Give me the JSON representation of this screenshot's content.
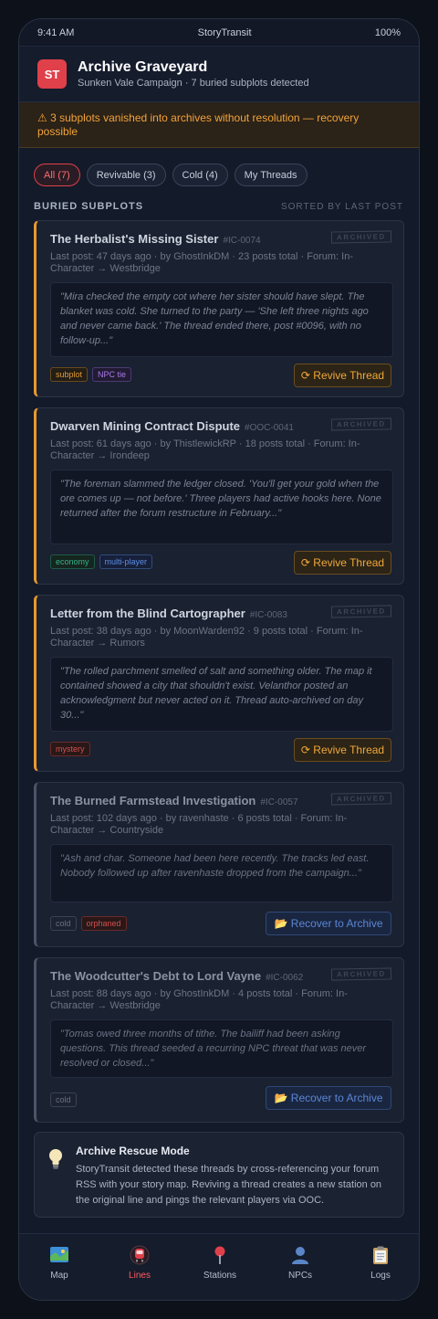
{
  "status": {
    "time": "9:41 AM",
    "app": "StoryTransit",
    "battery": "100%"
  },
  "header": {
    "logo": "ST",
    "title": "Archive Graveyard",
    "subtitle": "Sunken Vale Campaign · 7 buried subplots detected"
  },
  "banner": {
    "icon": "warning-icon",
    "text": "⚠ 3 subplots vanished into archives without resolution — recovery possible"
  },
  "filters": [
    {
      "label": "All (7)",
      "active": true
    },
    {
      "label": "Revivable (3)",
      "active": false
    },
    {
      "label": "Cold (4)",
      "active": false
    },
    {
      "label": "My Threads",
      "active": false
    }
  ],
  "section": {
    "title": "BURIED SUBPLOTS",
    "sort": "SORTED BY LAST POST"
  },
  "stamp": "ARCHIVED",
  "threads": [
    {
      "title": "The Herbalist's Missing Sister",
      "id": "#IC-0074",
      "meta": "Last post: 47 days ago · by GhostInkDM · 23 posts total · Forum: In-Character → Westbridge",
      "quote": "\"Mira checked the empty cot where her sister should have slept. The blanket was cold. She turned to the party — 'She left three nights ago and never came back.' The thread ended there, post #0096, with no follow-up...\"",
      "tags": [
        "subplot",
        "NPC tie"
      ],
      "action": "⟳ Revive Thread",
      "state": "revivable"
    },
    {
      "title": "Dwarven Mining Contract Dispute",
      "id": "#OOC-0041",
      "meta": "Last post: 61 days ago · by ThistlewickRP · 18 posts total · Forum: In-Character → Irondeep",
      "quote": "\"The foreman slammed the ledger closed. 'You'll get your gold when the ore comes up — not before.' Three players had active hooks here. None returned after the forum restructure in February...\"",
      "tags": [
        "economy",
        "multi-player"
      ],
      "action": "⟳ Revive Thread",
      "state": "revivable"
    },
    {
      "title": "Letter from the Blind Cartographer",
      "id": "#IC-0083",
      "meta": "Last post: 38 days ago · by MoonWarden92 · 9 posts total · Forum: In-Character → Rumors",
      "quote": "\"The rolled parchment smelled of salt and something older. The map it contained showed a city that shouldn't exist. Velanthor posted an acknowledgment but never acted on it. Thread auto-archived on day 30...\"",
      "tags": [
        "mystery"
      ],
      "action": "⟳ Revive Thread",
      "state": "revivable"
    },
    {
      "title": "The Burned Farmstead Investigation",
      "id": "#IC-0057",
      "meta": "Last post: 102 days ago · by ravenhaste · 6 posts total · Forum: In-Character → Countryside",
      "quote": "\"Ash and char. Someone had been here recently. The tracks led east. Nobody followed up after ravenhaste dropped from the campaign...\"",
      "tags": [
        "cold",
        "orphaned"
      ],
      "action": "📂 Recover to Archive",
      "state": "cold"
    },
    {
      "title": "The Woodcutter's Debt to Lord Vayne",
      "id": "#IC-0062",
      "meta": "Last post: 88 days ago · by GhostInkDM · 4 posts total · Forum: In-Character → Westbridge",
      "quote": "\"Tomas owed three months of tithe. The bailiff had been asking questions. This thread seeded a recurring NPC threat that was never resolved or closed...\"",
      "tags": [
        "cold"
      ],
      "action": "📂 Recover to Archive",
      "state": "cold"
    }
  ],
  "rescue": {
    "icon": "lightbulb-icon",
    "title": "Archive Rescue Mode",
    "text": "StoryTransit detected these threads by cross-referencing your forum RSS with your story map. Reviving a thread creates a new station on the original line and pings the relevant players via OOC."
  },
  "nav": [
    {
      "label": "Map",
      "icon": "map-icon",
      "active": false
    },
    {
      "label": "Lines",
      "icon": "train-icon",
      "active": true
    },
    {
      "label": "Stations",
      "icon": "pin-icon",
      "active": false
    },
    {
      "label": "NPCs",
      "icon": "person-icon",
      "active": false
    },
    {
      "label": "Logs",
      "icon": "clipboard-icon",
      "active": false
    }
  ],
  "colors": {
    "accent": "#e0404a",
    "amber": "#f0a83a",
    "link": "#5b86d4"
  }
}
